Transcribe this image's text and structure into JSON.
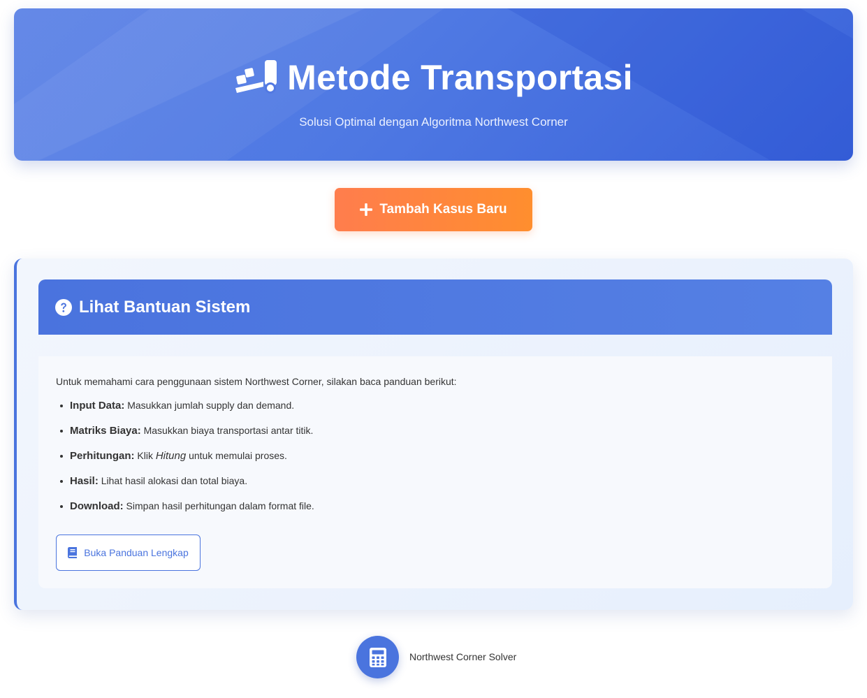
{
  "header": {
    "title": "Metode Transportasi",
    "subtitle": "Solusi Optimal dengan Algoritma Northwest Corner",
    "icon": "truck-loading-icon"
  },
  "actions": {
    "add_case_label": "Tambah Kasus Baru",
    "add_case_icon": "plus-icon"
  },
  "help": {
    "title": "Lihat Bantuan Sistem",
    "title_icon": "question-circle-icon",
    "intro": "Untuk memahami cara penggunaan sistem Northwest Corner, silakan baca panduan berikut:",
    "items": [
      {
        "label": "Input Data:",
        "text": "Masukkan jumlah supply dan demand."
      },
      {
        "label": "Matriks Biaya:",
        "text": "Masukkan biaya transportasi antar titik."
      },
      {
        "label": "Perhitungan:",
        "text_before": "Klik",
        "emphasis": "Hitung",
        "text_after": "untuk memulai proses."
      },
      {
        "label": "Hasil:",
        "text": "Lihat hasil alokasi dan total biaya."
      },
      {
        "label": "Download:",
        "text": "Simpan hasil perhitungan dalam format file."
      }
    ],
    "guide_button_label": "Buka Panduan Lengkap",
    "guide_button_icon": "book-icon"
  },
  "footer": {
    "text": "Northwest Corner Solver",
    "icon": "calculator-icon"
  },
  "colors": {
    "primary": "#4a74de",
    "accent": "#ff8a3d",
    "text": "#333333"
  }
}
